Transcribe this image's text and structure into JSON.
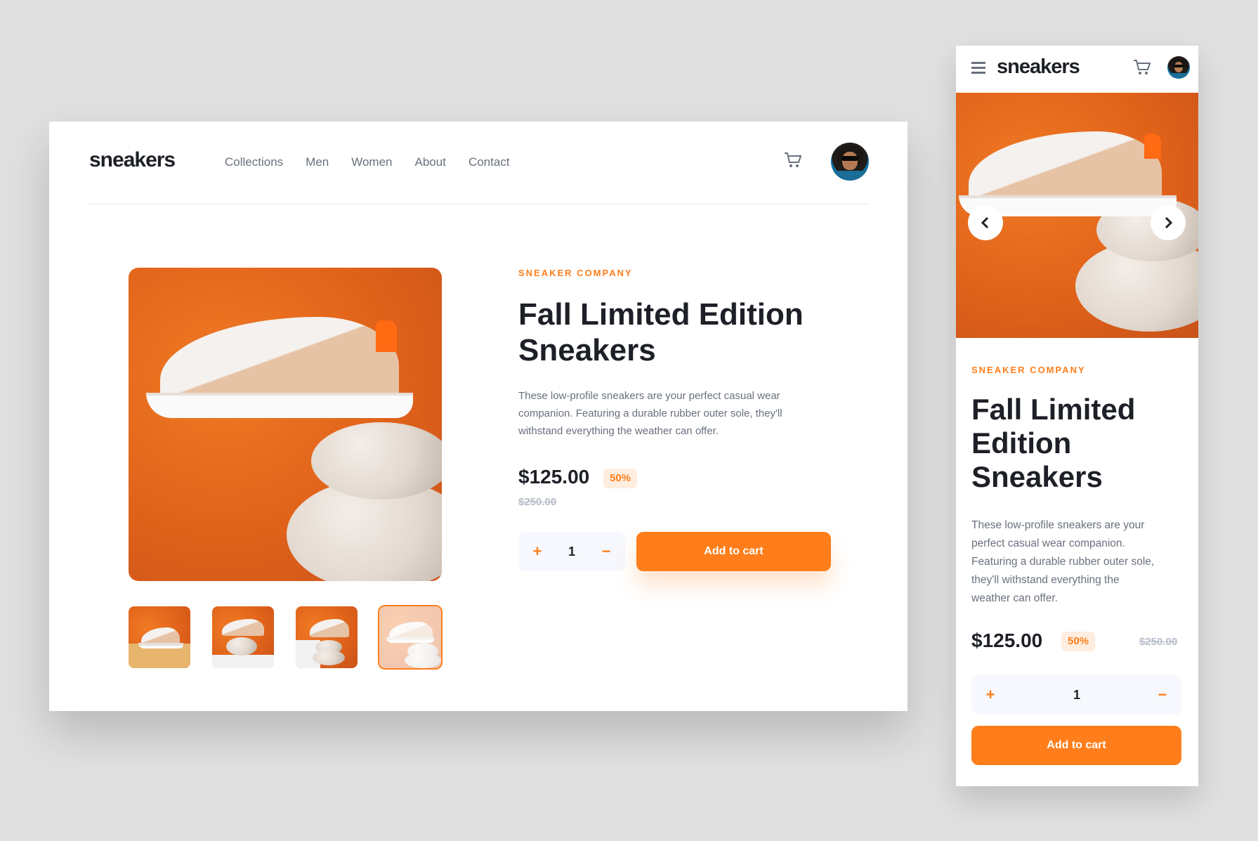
{
  "desktop": {
    "logo": "sneakers",
    "nav": [
      "Collections",
      "Men",
      "Women",
      "About",
      "Contact"
    ],
    "company": "SNEAKER COMPANY",
    "title_line1": "Fall Limited Edition",
    "title_line2": "Sneakers",
    "description": "These low-profile sneakers are your perfect casual wear companion. Featuring a durable rubber outer sole, they'll withstand everything the weather can offer.",
    "description_lines": [
      "These low-profile sneakers are your perfect casual wear",
      "companion. Featuring a durable rubber outer sole, they'll",
      "withstand everything the weather can offer."
    ],
    "price": "$125.00",
    "discount": "50%",
    "original_price": "$250.00",
    "quantity": "1",
    "plus": "+",
    "minus": "−",
    "add_to_cart": "Add to cart",
    "active_thumbnail": 4
  },
  "mobile": {
    "logo": "sneakers",
    "company": "SNEAKER COMPANY",
    "title_lines": [
      "Fall Limited",
      "Edition",
      "Sneakers"
    ],
    "description_lines": [
      "These low-profile sneakers are your",
      "perfect casual wear companion.",
      "Featuring a durable rubber outer sole,",
      "they'll withstand everything the",
      "weather can offer."
    ],
    "price": "$125.00",
    "discount": "50%",
    "original_price": "$250.00",
    "quantity": "1",
    "plus": "+",
    "minus": "−",
    "add_to_cart": "Add to cart"
  },
  "colors": {
    "accent": "#ff7e1b",
    "accent_pale": "#ffede0",
    "dark_text": "#1d2026",
    "muted_text": "#69707d",
    "strike_text": "#b6bcc8",
    "stepper_bg": "#f6f8fd",
    "backdrop": "#e0e0e0"
  },
  "icons": {
    "cart": "cart-icon",
    "menu": "hamburger-menu-icon",
    "prev": "chevron-left-icon",
    "next": "chevron-right-icon"
  }
}
